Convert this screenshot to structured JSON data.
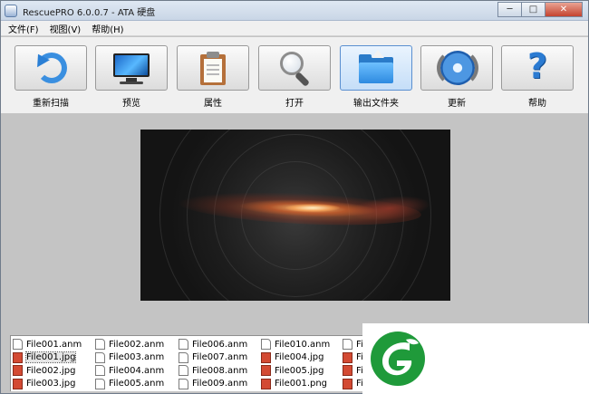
{
  "window": {
    "title": "RescuePRO 6.0.0.7 - ATA 硬盘"
  },
  "menu": [
    "文件(F)",
    "视图(V)",
    "帮助(H)"
  ],
  "toolbar": {
    "buttons": [
      {
        "label": "重新扫描",
        "icon": "rescan-icon"
      },
      {
        "label": "预览",
        "icon": "monitor-icon"
      },
      {
        "label": "属性",
        "icon": "clipboard-icon"
      },
      {
        "label": "打开",
        "icon": "magnifier-icon"
      },
      {
        "label": "输出文件夹",
        "icon": "folder-icon",
        "active": true
      },
      {
        "label": "更新",
        "icon": "update-icon"
      },
      {
        "label": "帮助",
        "icon": "help-icon"
      }
    ]
  },
  "files": {
    "columns": [
      [
        {
          "name": "File001.anm",
          "type": "doc"
        },
        {
          "name": "File001.jpg",
          "type": "jpg",
          "selected": true
        },
        {
          "name": "File002.jpg",
          "type": "jpg"
        },
        {
          "name": "File003.jpg",
          "type": "jpg"
        }
      ],
      [
        {
          "name": "File002.anm",
          "type": "doc"
        },
        {
          "name": "File003.anm",
          "type": "doc"
        },
        {
          "name": "File004.anm",
          "type": "doc"
        },
        {
          "name": "File005.anm",
          "type": "doc"
        }
      ],
      [
        {
          "name": "File006.anm",
          "type": "doc"
        },
        {
          "name": "File007.anm",
          "type": "doc"
        },
        {
          "name": "File008.anm",
          "type": "doc"
        },
        {
          "name": "File009.anm",
          "type": "doc"
        }
      ],
      [
        {
          "name": "File010.anm",
          "type": "doc"
        },
        {
          "name": "File004.jpg",
          "type": "jpg"
        },
        {
          "name": "File005.jpg",
          "type": "jpg"
        },
        {
          "name": "File001.png",
          "type": "doc"
        }
      ],
      [
        {
          "name": "Fi",
          "type": "doc"
        },
        {
          "name": "Fi",
          "type": "jpg"
        },
        {
          "name": "Fi",
          "type": "jpg"
        },
        {
          "name": "Fi",
          "type": "jpg"
        }
      ]
    ]
  },
  "colors": {
    "accent": "#2a7bc9",
    "logo_green": "#1f9a3a"
  }
}
